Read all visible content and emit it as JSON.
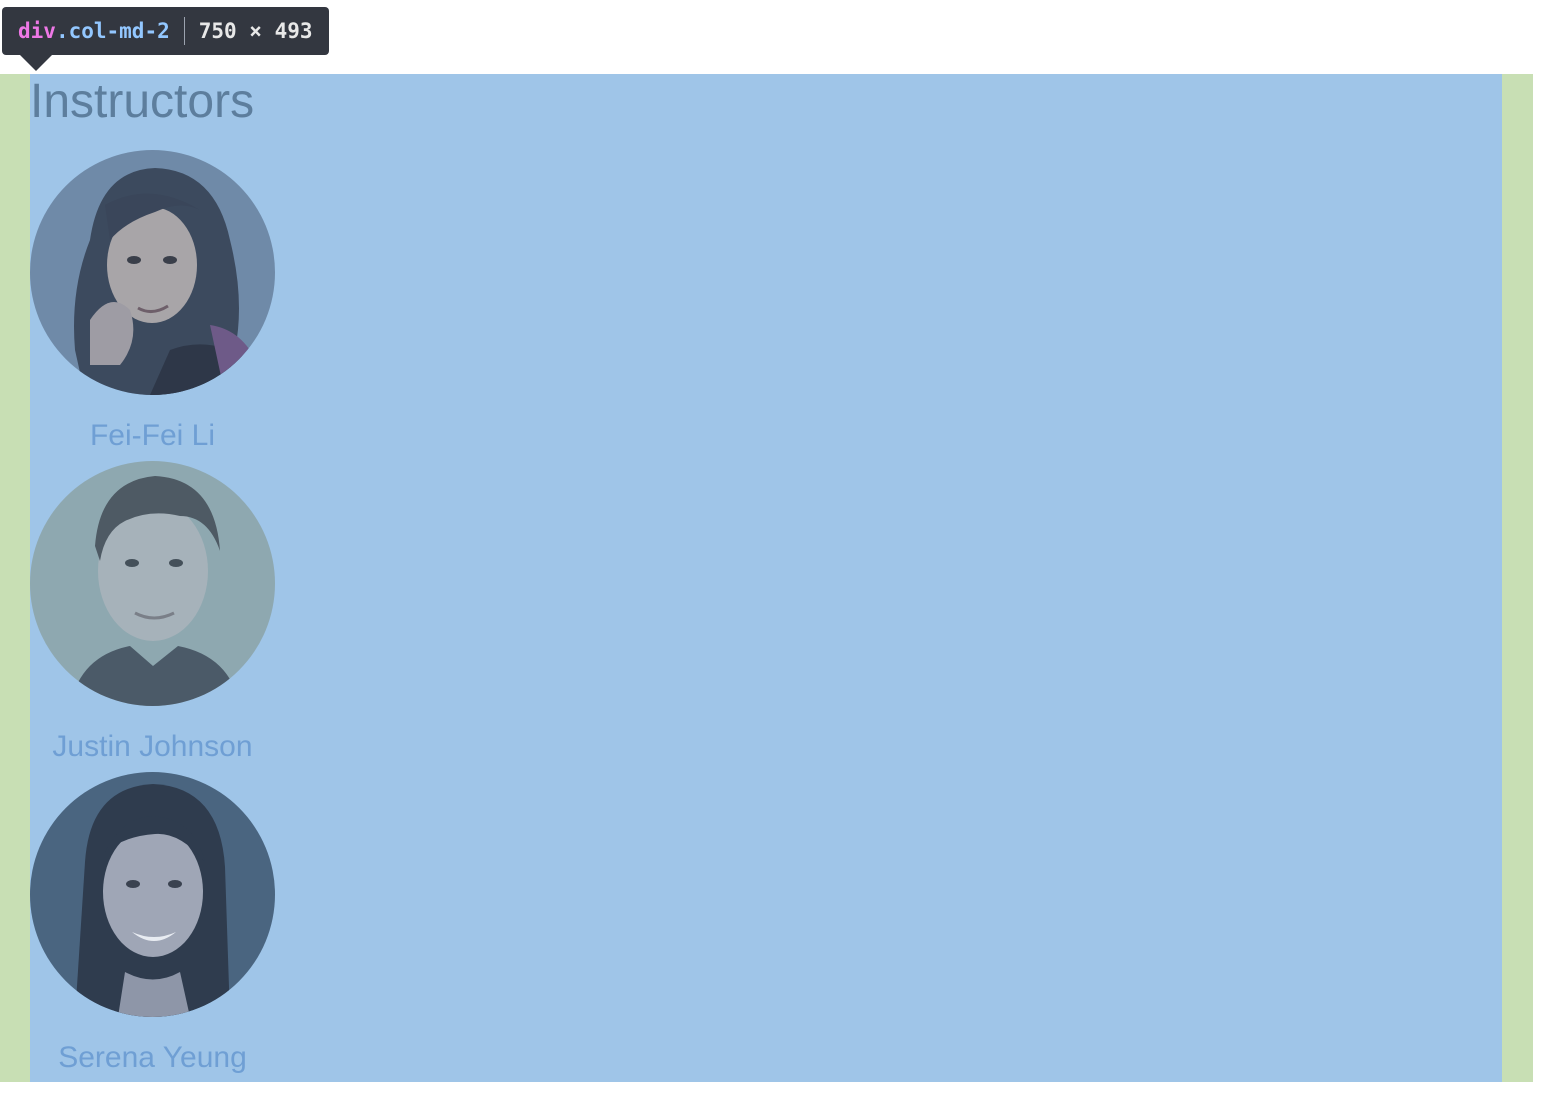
{
  "inspector": {
    "tag": "div",
    "class_name": ".col-md-2",
    "dimensions": "750 × 493"
  },
  "colors": {
    "padding_highlight": "#c8dfb4",
    "content_highlight": "#9fc5e8",
    "tooltip_bg": "#333740",
    "link": "#6f9fd4"
  },
  "section": {
    "title": "Instructors"
  },
  "instructors": [
    {
      "name": "Fei-Fei Li",
      "photo": "portrait-woman-dark-curly-hair"
    },
    {
      "name": "Justin Johnson",
      "photo": "portrait-man-short-hair"
    },
    {
      "name": "Serena Yeung",
      "photo": "portrait-woman-long-dark-hair"
    }
  ]
}
